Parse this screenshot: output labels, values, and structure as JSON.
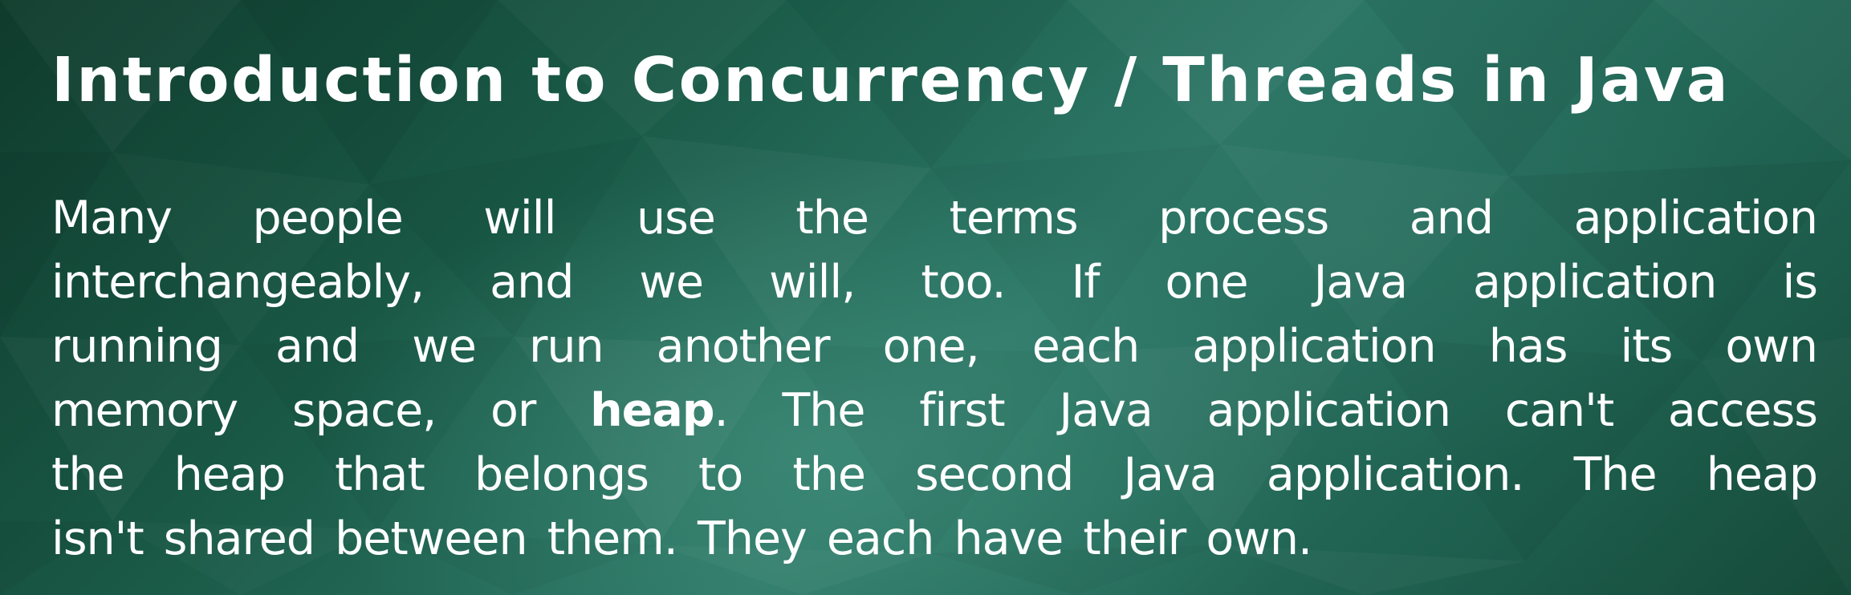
{
  "slide": {
    "title": "Introduction to Concurrency / Threads in Java",
    "paragraph": {
      "line1": "Many people will use the terms process and application",
      "line2": "interchangeably, and we will, too. If one Java application is",
      "line3": "running and we run another one, each application has its own",
      "line4_before": "memory space, or ",
      "line4_bold": "heap",
      "line4_after": ". The first Java application can't access",
      "line5": "the heap that belongs to the second Java application. The heap",
      "line6": "isn't shared between them. They each have their own."
    }
  },
  "theme": {
    "background_dark": "#0f3b2c",
    "background_mid": "#2d7767",
    "text_color": "#ffffff"
  }
}
